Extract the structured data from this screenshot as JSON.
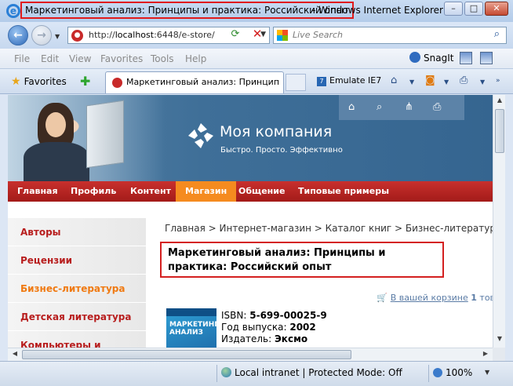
{
  "window": {
    "title": "Маркетинговый анализ: Принципы и практика: Российский опыт",
    "title_suffix": "- Windows Internet Explorer",
    "minimize": "–",
    "maximize": "□",
    "close": "✕"
  },
  "addressbar": {
    "url_prefix": "http://",
    "url_host": "localhost",
    "url_rest": ":6448/e-store/",
    "search_placeholder": "Live Search"
  },
  "menu": [
    "File",
    "Edit",
    "View",
    "Favorites",
    "Tools",
    "Help"
  ],
  "snagit_label": "SnagIt",
  "tabs": {
    "favorites_label": "Favorites",
    "active_tab": "Маркетинговый анализ: Принцип...",
    "emulate_label": "Emulate IE7"
  },
  "site": {
    "brand": "Моя компания",
    "slogan": "Быстро. Просто. Эффективно",
    "nav": [
      "Главная",
      "Профиль",
      "Контент",
      "Магазин",
      "Общение",
      "Типовые примеры"
    ],
    "active_nav": "Магазин",
    "sidebar": [
      "Авторы",
      "Рецензии",
      "Бизнес-литература",
      "Детская литература",
      "Компьютеры и"
    ],
    "active_sidebar": "Бизнес-литература",
    "breadcrumb": "Главная > Интернет-магазин > Каталог книг > Бизнес-литература",
    "product_title": "Маркетинговый анализ: Принципы и практика: Российский опыт",
    "cart_text": "В вашей корзине",
    "cart_count": "1",
    "cart_suffix": "тов",
    "book_cover_text": "МАРКЕТИНГОВЫЙ АНАЛИЗ",
    "isbn_label": "ISBN:",
    "isbn_value": "5-699-00025-9",
    "year_label": "Год выпуска:",
    "year_value": "2002",
    "publisher_label": "Издатель:",
    "publisher_value": "Эксмо"
  },
  "status": {
    "zone": "Local intranet | Protected Mode: Off",
    "zoom": "100%"
  }
}
